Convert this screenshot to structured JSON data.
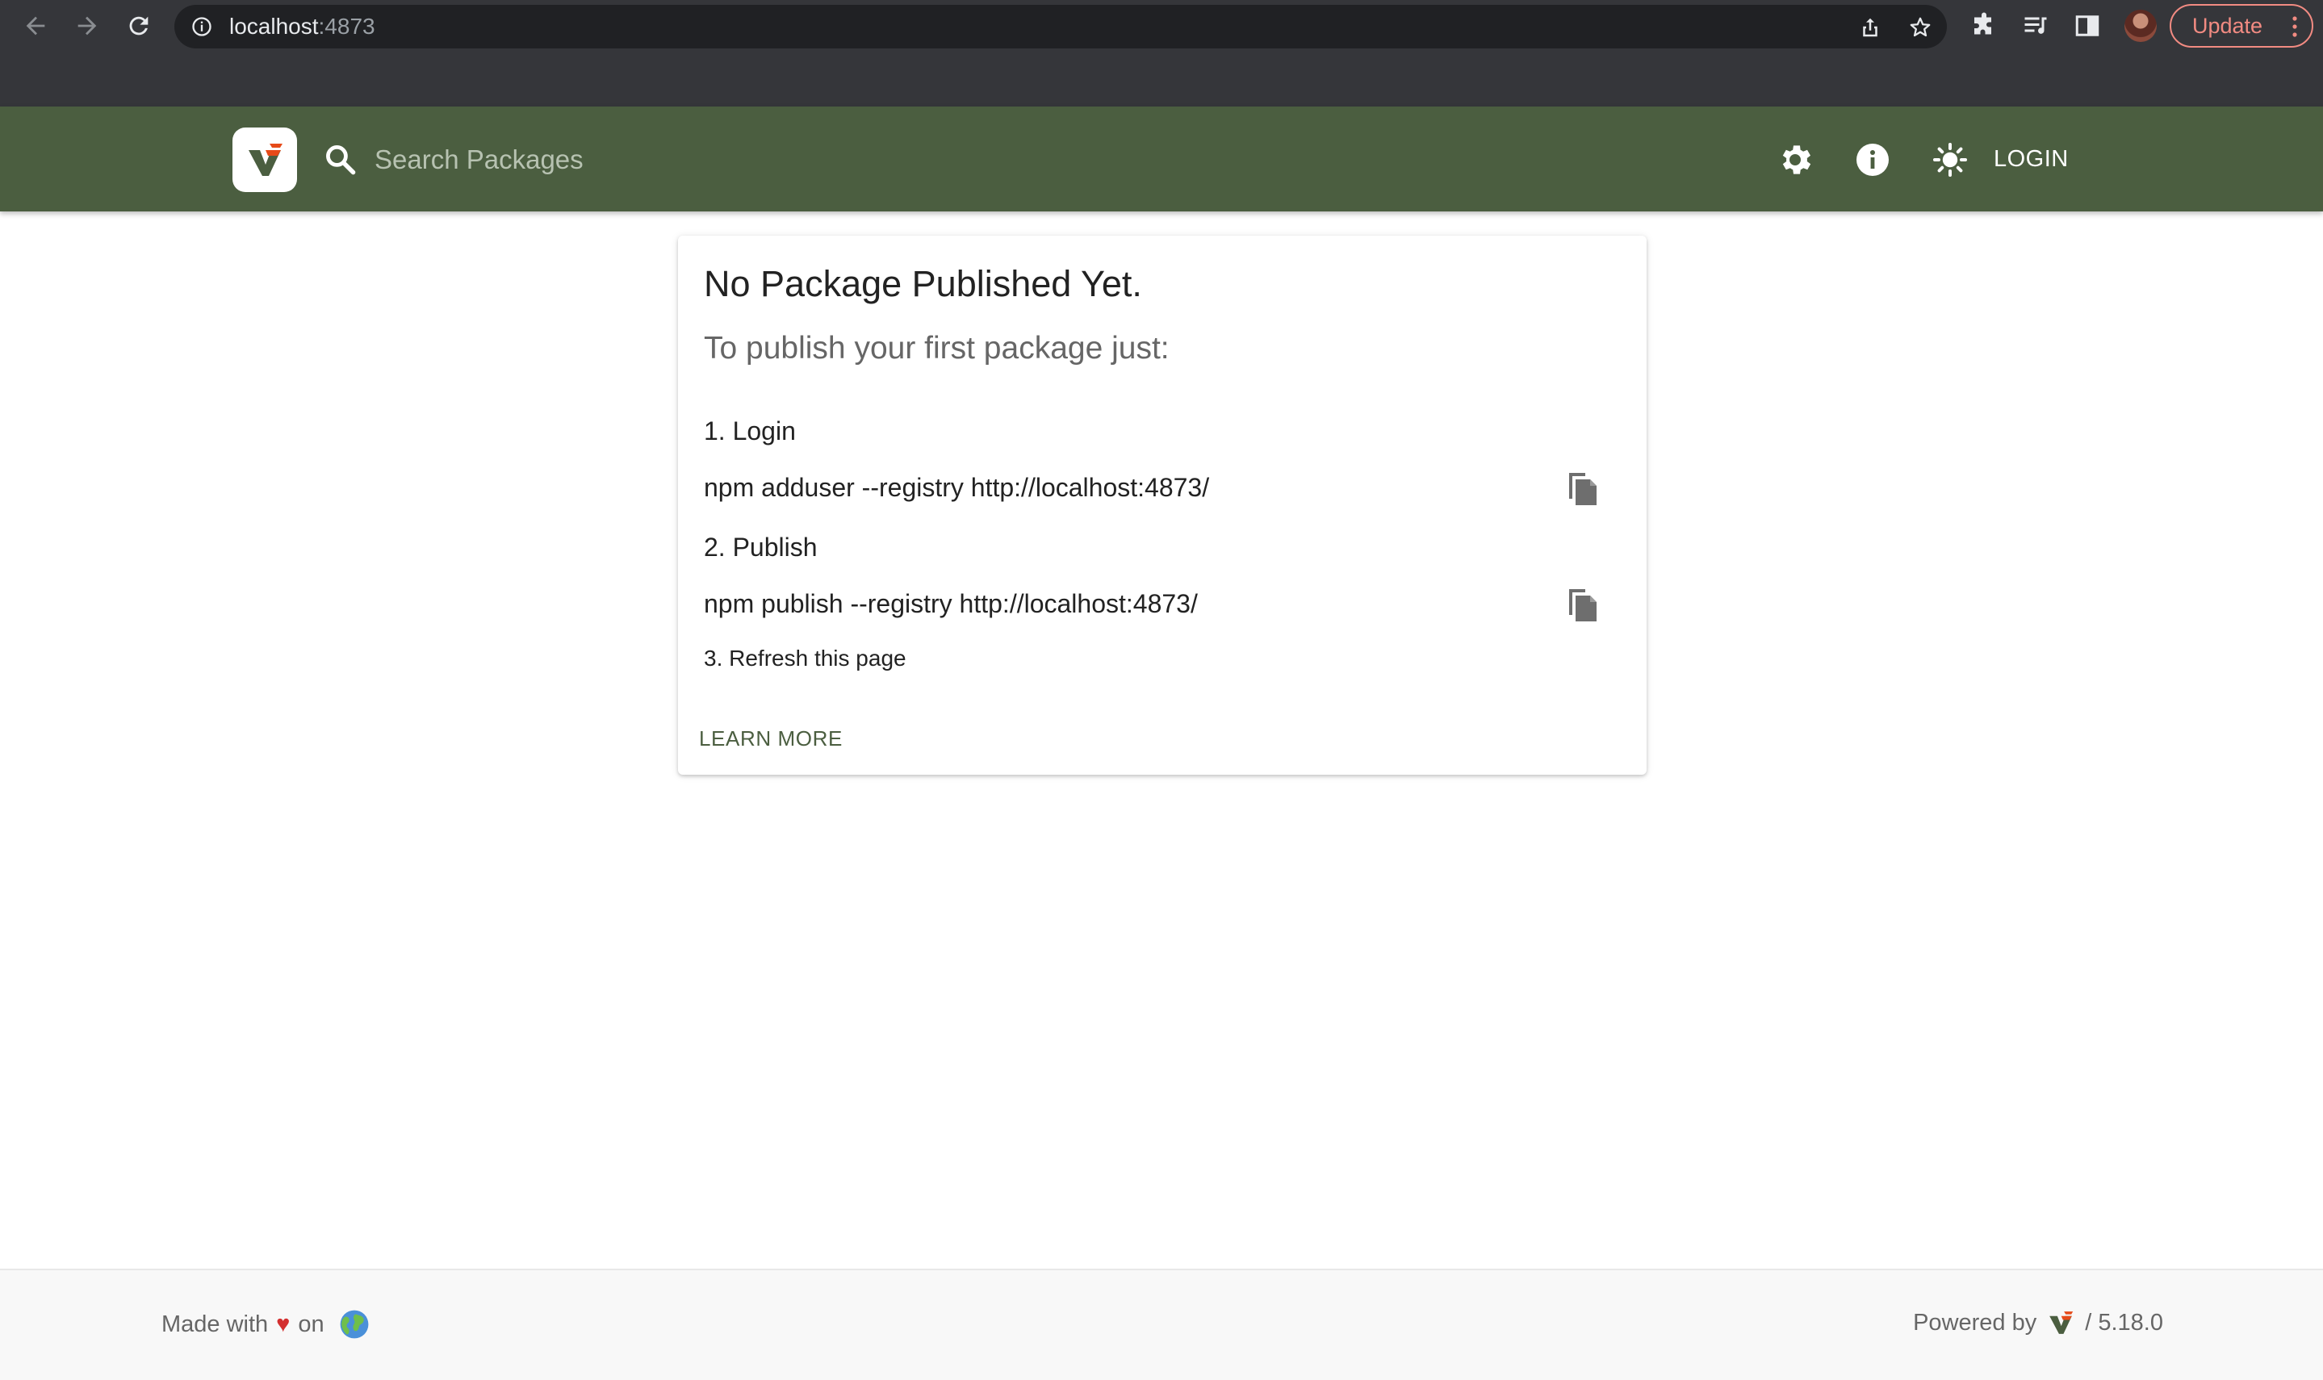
{
  "browser": {
    "url_host": "localhost",
    "url_port": ":4873",
    "update_label": "Update",
    "icons": [
      "back-arrow-icon",
      "forward-arrow-icon",
      "reload-icon",
      "info-circle-icon",
      "share-icon",
      "star-icon",
      "puzzle-extensions-icon",
      "media-queue-icon",
      "side-panel-icon",
      "more-vert-icon"
    ]
  },
  "header": {
    "search_placeholder": "Search Packages",
    "login_label": "LOGIN",
    "icons": [
      "verdaccio-logo-icon",
      "search-icon",
      "gear-icon",
      "info-icon",
      "brightness-icon"
    ],
    "brand_color": "#4b5e40"
  },
  "card": {
    "title": "No Package Published Yet.",
    "subtitle": "To publish your first package just:",
    "step1": "1. Login",
    "cmd1": "npm adduser --registry http://localhost:4873/",
    "step2": "2. Publish",
    "cmd2": "npm publish --registry http://localhost:4873/",
    "step3": "3. Refresh this page",
    "learn_more": "LEARN MORE",
    "icons": [
      "copy-icon"
    ]
  },
  "footer": {
    "made_with": "Made with",
    "heart": "♥",
    "on": "on",
    "powered_by": "Powered by",
    "version": "/ 5.18.0",
    "icons": [
      "heart-icon",
      "globe-icon",
      "verdaccio-mini-logo-icon"
    ]
  }
}
